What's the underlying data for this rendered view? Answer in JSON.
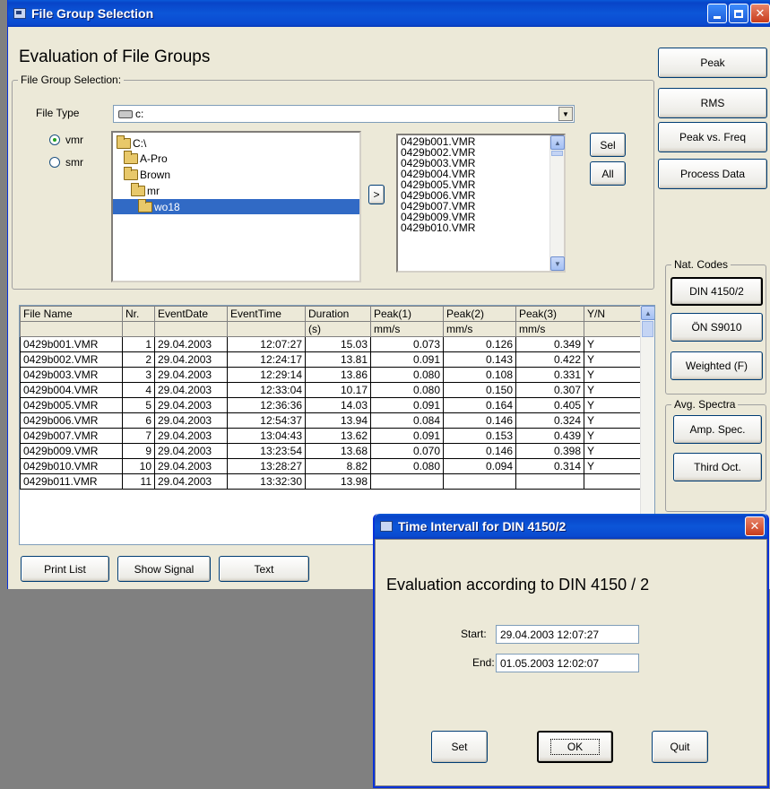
{
  "window": {
    "title": "File Group Selection"
  },
  "header": {
    "title": "Evaluation of File Groups"
  },
  "file_group": {
    "legend": "File Group Selection:",
    "file_type_label": "File Type",
    "drive": "c:",
    "radio_vmr": "vmr",
    "radio_smr": "smr",
    "tree": [
      "C:\\",
      "A-Pro",
      "Brown",
      "mr",
      "wo18"
    ],
    "move_button": ">",
    "files": [
      "0429b001.VMR",
      "0429b002.VMR",
      "0429b003.VMR",
      "0429b004.VMR",
      "0429b005.VMR",
      "0429b006.VMR",
      "0429b007.VMR",
      "0429b009.VMR",
      "0429b010.VMR"
    ],
    "sel_button": "Sel",
    "all_button": "All"
  },
  "right_panel": {
    "peak": "Peak",
    "rms": "RMS",
    "peak_vs_freq": "Peak vs. Freq",
    "process_data": "Process Data",
    "nat_codes_legend": "Nat. Codes",
    "din": "DIN 4150/2",
    "onorm": "ÖN S9010",
    "weighted": "Weighted (F)",
    "avg_legend": "Avg. Spectra",
    "amp_spec": "Amp. Spec.",
    "third_oct": "Third Oct."
  },
  "table": {
    "headers": [
      "File Name",
      "Nr.",
      "EventDate",
      "EventTime",
      "Duration",
      "Peak(1)",
      "Peak(2)",
      "Peak(3)",
      "Y/N"
    ],
    "units": [
      "",
      "",
      "",
      "",
      "(s)",
      "mm/s",
      "mm/s",
      "mm/s",
      ""
    ],
    "rows": [
      [
        "0429b001.VMR",
        "1",
        "29.04.2003",
        "12:07:27",
        "15.03",
        "0.073",
        "0.126",
        "0.349",
        "Y"
      ],
      [
        "0429b002.VMR",
        "2",
        "29.04.2003",
        "12:24:17",
        "13.81",
        "0.091",
        "0.143",
        "0.422",
        "Y"
      ],
      [
        "0429b003.VMR",
        "3",
        "29.04.2003",
        "12:29:14",
        "13.86",
        "0.080",
        "0.108",
        "0.331",
        "Y"
      ],
      [
        "0429b004.VMR",
        "4",
        "29.04.2003",
        "12:33:04",
        "10.17",
        "0.080",
        "0.150",
        "0.307",
        "Y"
      ],
      [
        "0429b005.VMR",
        "5",
        "29.04.2003",
        "12:36:36",
        "14.03",
        "0.091",
        "0.164",
        "0.405",
        "Y"
      ],
      [
        "0429b006.VMR",
        "6",
        "29.04.2003",
        "12:54:37",
        "13.94",
        "0.084",
        "0.146",
        "0.324",
        "Y"
      ],
      [
        "0429b007.VMR",
        "7",
        "29.04.2003",
        "13:04:43",
        "13.62",
        "0.091",
        "0.153",
        "0.439",
        "Y"
      ],
      [
        "0429b009.VMR",
        "9",
        "29.04.2003",
        "13:23:54",
        "13.68",
        "0.070",
        "0.146",
        "0.398",
        "Y"
      ],
      [
        "0429b010.VMR",
        "10",
        "29.04.2003",
        "13:28:27",
        "8.82",
        "0.080",
        "0.094",
        "0.314",
        "Y"
      ],
      [
        "0429b011.VMR",
        "11",
        "29.04.2003",
        "13:32:30",
        "13.98",
        "",
        "",
        "",
        ""
      ]
    ]
  },
  "bottom": {
    "print_list": "Print List",
    "show_signal": "Show Signal",
    "text": "Text"
  },
  "dialog": {
    "title": "Time Intervall for DIN 4150/2",
    "heading": "Evaluation according to DIN 4150 / 2",
    "start_label": "Start:",
    "start_value": "29.04.2003 12:07:27",
    "end_label": "End:",
    "end_value": "01.05.2003 12:02:07",
    "set": "Set",
    "ok": "OK",
    "quit": "Quit"
  }
}
